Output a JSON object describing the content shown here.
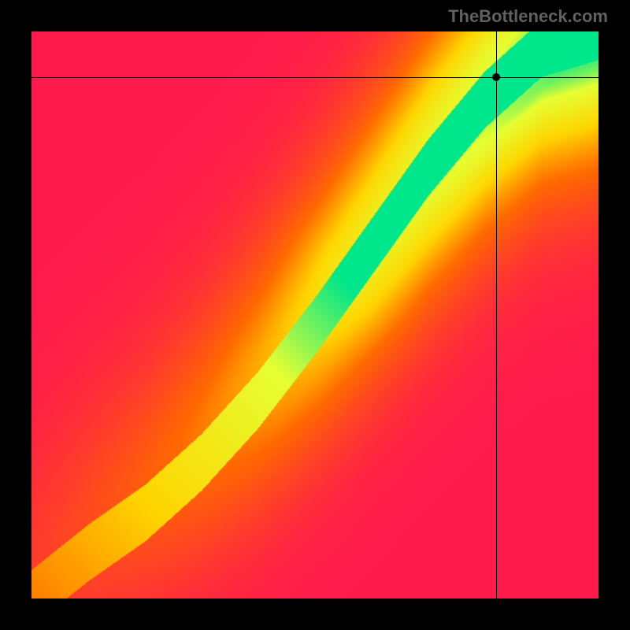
{
  "watermark": "TheBottleneck.com",
  "chart_data": {
    "type": "heatmap",
    "title": "",
    "xlabel": "",
    "ylabel": "",
    "xlim": [
      0,
      100
    ],
    "ylim": [
      0,
      100
    ],
    "marker": {
      "x": 82,
      "y": 92
    },
    "crosshair": {
      "x": 82,
      "y": 92
    },
    "optimal_curve": [
      {
        "x": 0,
        "y": 0
      },
      {
        "x": 10,
        "y": 8
      },
      {
        "x": 20,
        "y": 15
      },
      {
        "x": 30,
        "y": 24
      },
      {
        "x": 40,
        "y": 35
      },
      {
        "x": 50,
        "y": 48
      },
      {
        "x": 60,
        "y": 62
      },
      {
        "x": 70,
        "y": 76
      },
      {
        "x": 80,
        "y": 88
      },
      {
        "x": 90,
        "y": 97
      },
      {
        "x": 100,
        "y": 100
      }
    ],
    "color_stops": [
      {
        "t": 0.0,
        "color": "#ff1a4d"
      },
      {
        "t": 0.35,
        "color": "#ff6a00"
      },
      {
        "t": 0.6,
        "color": "#ffd500"
      },
      {
        "t": 0.85,
        "color": "#e6ff33"
      },
      {
        "t": 1.0,
        "color": "#00e68a"
      }
    ],
    "band_width": 0.1
  }
}
